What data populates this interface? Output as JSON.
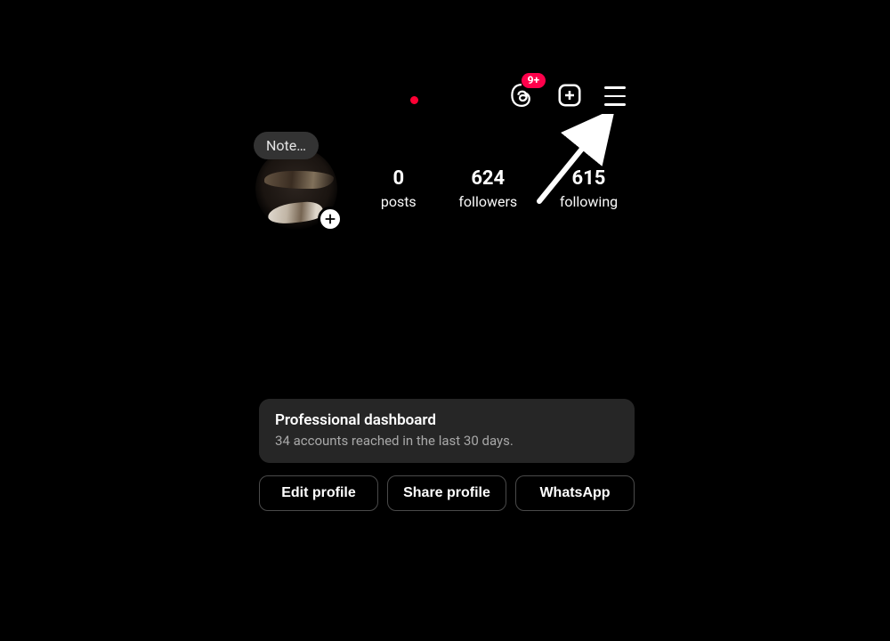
{
  "header": {
    "notification_dot_color": "#ff0034",
    "threads_badge": "9+",
    "icons": {
      "threads": "threads-icon",
      "create": "create-post-icon",
      "menu": "hamburger-menu-icon"
    }
  },
  "profile": {
    "note_placeholder": "Note…",
    "add_icon": "plus-icon",
    "stats": {
      "posts": {
        "count": "0",
        "label": "posts"
      },
      "followers": {
        "count": "624",
        "label": "followers"
      },
      "following": {
        "count": "615",
        "label": "following"
      }
    }
  },
  "dashboard": {
    "title": "Professional dashboard",
    "subtitle": "34 accounts reached in the last 30 days."
  },
  "actions": {
    "edit": "Edit profile",
    "share": "Share profile",
    "whatsapp": "WhatsApp"
  },
  "annotation": {
    "arrow_target": "menu-button"
  }
}
